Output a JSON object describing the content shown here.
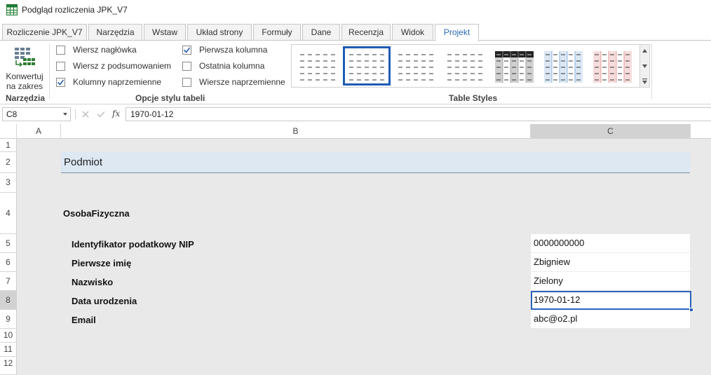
{
  "window": {
    "title": "Podgląd rozliczenia JPK_V7",
    "icon": "spreadsheet-icon"
  },
  "tabs": [
    {
      "label": "Rozliczenie JPK_V7"
    },
    {
      "label": "Narzędzia"
    },
    {
      "label": "Wstaw"
    },
    {
      "label": "Układ strony"
    },
    {
      "label": "Formuły"
    },
    {
      "label": "Dane"
    },
    {
      "label": "Recenzja"
    },
    {
      "label": "Widok"
    },
    {
      "label": "Projekt",
      "active": true
    }
  ],
  "ribbon": {
    "tools": {
      "button_line1": "Konwertuj",
      "button_line2": "na zakres",
      "group_label": "Narzędzia"
    },
    "style_options": {
      "group_label": "Opcje stylu tabeli",
      "options": [
        {
          "label": "Wiersz nagłówka",
          "checked": false
        },
        {
          "label": "Wiersz z podsumowaniem",
          "checked": false
        },
        {
          "label": "Kolumny naprzemienne",
          "checked": true
        },
        {
          "label": "Pierwsza kolumna",
          "checked": true
        },
        {
          "label": "Ostatnia kolumna",
          "checked": false
        },
        {
          "label": "Wiersze naprzemienne",
          "checked": false
        }
      ]
    },
    "table_styles": {
      "group_label": "Table Styles",
      "styles": [
        {
          "name": "none",
          "accent": "#666666"
        },
        {
          "name": "light-selected",
          "accent": "#666666",
          "selected": true
        },
        {
          "name": "light-2",
          "accent": "#666666"
        },
        {
          "name": "light-3",
          "accent": "#666666"
        },
        {
          "name": "dark-gray",
          "accent": "#9a9a9a"
        },
        {
          "name": "light-blue",
          "accent": "#7aa3d6"
        },
        {
          "name": "light-red",
          "accent": "#e08b8b"
        }
      ]
    }
  },
  "formula_bar": {
    "cell_ref": "C8",
    "cancel_icon": "cancel-icon",
    "confirm_icon": "check-icon",
    "fx_label": "fx",
    "value": "1970-01-12"
  },
  "sheet": {
    "columns": [
      "A",
      "B",
      "C"
    ],
    "active_column": "C",
    "rows": [
      "1",
      "2",
      "3",
      "4",
      "5",
      "6",
      "7",
      "8",
      "9",
      "10",
      "11",
      "12"
    ],
    "active_row": "8",
    "section_title": "Podmiot",
    "subsection_title": "OsobaFizyczna",
    "fields": [
      {
        "label": "Identyfikator podatkowy NIP",
        "value": "0000000000"
      },
      {
        "label": "Pierwsze imię",
        "value": "Zbigniew"
      },
      {
        "label": "Nazwisko",
        "value": "Zielony"
      },
      {
        "label": "Data urodzenia",
        "value": "1970-01-12",
        "selected": true
      },
      {
        "label": "Email",
        "value": "abc@o2.pl"
      }
    ]
  },
  "colors": {
    "accent": "#2b6cb5",
    "selection": "#2a62b8",
    "section_band": "#dde8f3",
    "sheet_bg": "#e9e9e9"
  }
}
